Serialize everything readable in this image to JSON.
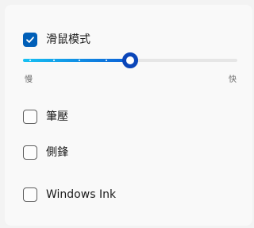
{
  "mouse_mode": {
    "label": "滑鼠模式",
    "checked": true
  },
  "speed_slider": {
    "min_label": "慢",
    "max_label": "快",
    "value": 0.5,
    "tick_count": 5,
    "accent_start": "#17c1f3",
    "accent_end": "#0b5fd6"
  },
  "options": [
    {
      "label": "筆壓",
      "checked": false
    },
    {
      "label": "側鋒",
      "checked": false
    },
    {
      "label": "Windows Ink",
      "checked": false
    }
  ]
}
